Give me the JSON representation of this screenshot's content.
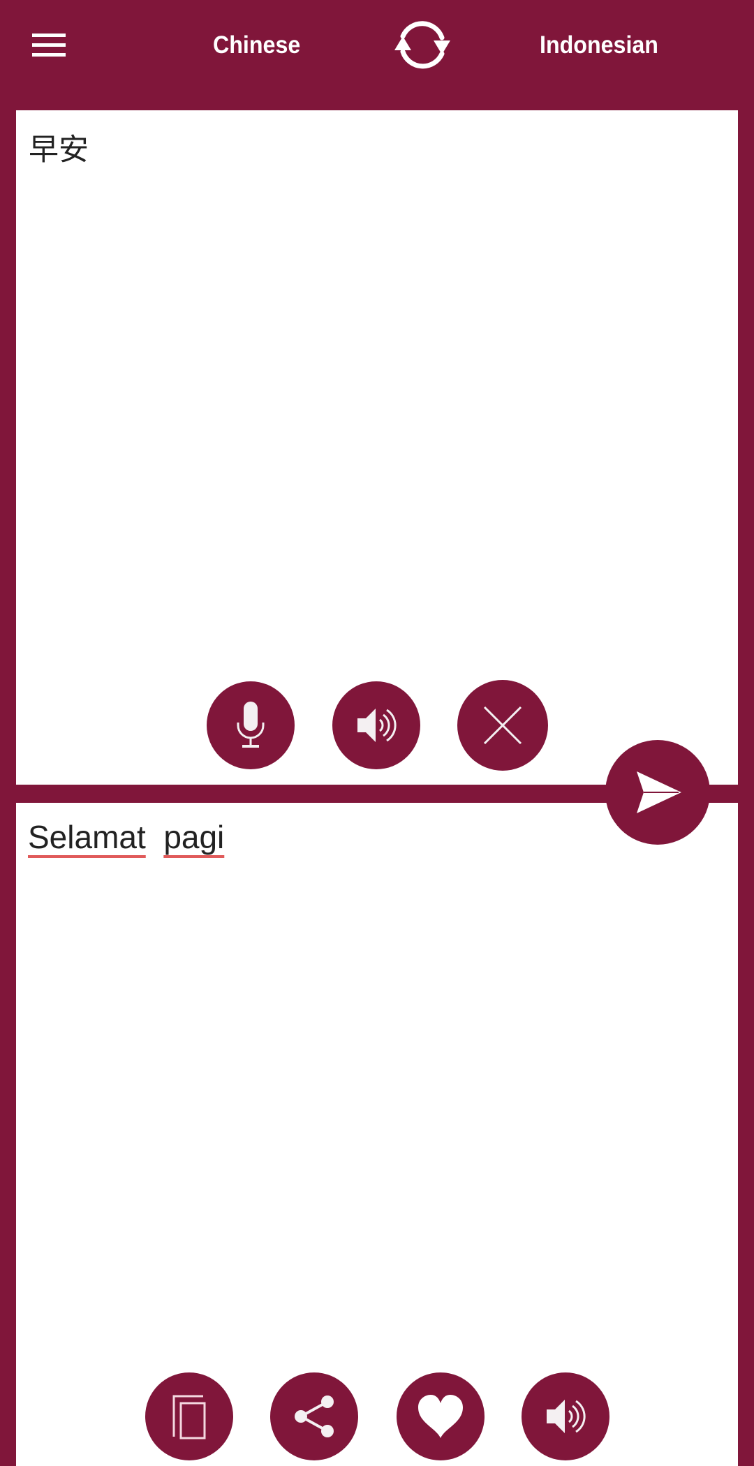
{
  "header": {
    "source_language": "Chinese",
    "target_language": "Indonesian",
    "menu_icon": "hamburger-menu-icon",
    "swap_icon": "swap-languages-icon"
  },
  "source_panel": {
    "text": "早安",
    "actions": [
      {
        "name": "microphone",
        "icon": "microphone-icon"
      },
      {
        "name": "speak-source",
        "icon": "speaker-icon"
      },
      {
        "name": "clear",
        "icon": "close-icon"
      }
    ]
  },
  "translate_button": {
    "icon": "send-icon"
  },
  "target_panel": {
    "words": [
      "Selamat",
      "pagi"
    ],
    "actions": [
      {
        "name": "copy",
        "icon": "copy-icon"
      },
      {
        "name": "share",
        "icon": "share-icon"
      },
      {
        "name": "favorite",
        "icon": "heart-icon"
      },
      {
        "name": "speak-target",
        "icon": "speaker-icon"
      }
    ]
  },
  "colors": {
    "brand": "#80163A",
    "background": "#FFFFFF",
    "text": "#222222",
    "spellcheck_underline": "#E05A5A"
  }
}
